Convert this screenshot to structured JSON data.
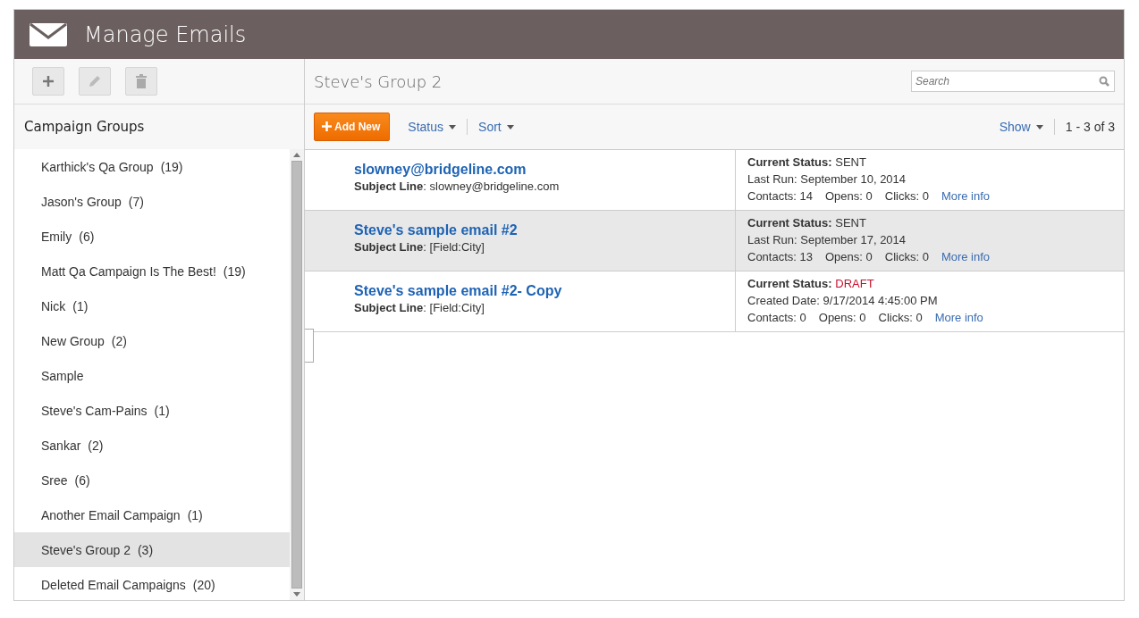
{
  "window": {
    "title": "Manage Emails"
  },
  "sidebar": {
    "title": "Campaign Groups",
    "items": [
      {
        "label": "Karthick's Qa Group",
        "count": "(19)",
        "selected": false
      },
      {
        "label": "Jason's Group",
        "count": "(7)",
        "selected": false
      },
      {
        "label": "Emily",
        "count": "(6)",
        "selected": false
      },
      {
        "label": "Matt Qa Campaign Is The Best!",
        "count": "(19)",
        "selected": false
      },
      {
        "label": "Nick",
        "count": "(1)",
        "selected": false
      },
      {
        "label": "New Group",
        "count": "(2)",
        "selected": false
      },
      {
        "label": "Sample",
        "selected": false
      },
      {
        "label": "Steve's Cam-Pains",
        "count": "(1)",
        "selected": false
      },
      {
        "label": "Sankar",
        "count": "(2)",
        "selected": false
      },
      {
        "label": "Sree",
        "count": "(6)",
        "selected": false
      },
      {
        "label": "Another Email Campaign",
        "count": "(1)",
        "selected": false
      },
      {
        "label": "Steve's Group 2",
        "count": "(3)",
        "selected": true
      },
      {
        "label": "Deleted Email Campaigns",
        "count": "(20)",
        "selected": false
      }
    ]
  },
  "main": {
    "title": "Steve's Group 2",
    "search": {
      "placeholder": "Search"
    },
    "toolbar": {
      "add": "Add New",
      "status": "Status",
      "sort": "Sort",
      "show": "Show",
      "range": "1 - 3 of 3"
    },
    "emails": [
      {
        "title": "slowney@bridgeline.com",
        "subject": "**Subject Line**: slowney@bridgeline.com",
        "status_label": "Current Status:",
        "status": "SENT",
        "kind": "sent",
        "date": "Last Run: September 10, 2014",
        "contacts": "Contacts: 14",
        "opens": "Opens: 0",
        "clicks": "Clicks: 0",
        "more": "More info",
        "selected": false
      },
      {
        "title": "Steve's sample email #2",
        "subject": "**Subject Line**: [Field:City]",
        "status_label": "Current Status:",
        "status": "SENT",
        "kind": "sent",
        "date": "Last Run: September 17, 2014",
        "contacts": "Contacts: 13",
        "opens": "Opens: 0",
        "clicks": "Clicks: 0",
        "more": "More info",
        "selected": true
      },
      {
        "title": "Steve's sample email #2- Copy",
        "subject": "**Subject Line**: [Field:City]",
        "status_label": "Current Status:",
        "status": "DRAFT",
        "kind": "draft",
        "date": "Created Date: 9/17/2014 4:45:00 PM",
        "contacts": "Contacts: 0",
        "opens": "Opens: 0",
        "clicks": "Clicks: 0",
        "more": "More info",
        "selected": false
      }
    ]
  }
}
